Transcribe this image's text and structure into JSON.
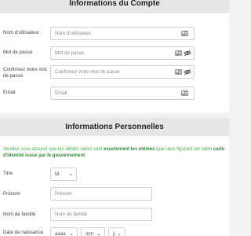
{
  "account": {
    "title": "Informations du Compte",
    "fields": [
      {
        "label": "Nom d'utilisateur",
        "placeholder": "Nom d'utilisateur"
      },
      {
        "label": "Mot de passe",
        "placeholder": "Mot de passe"
      },
      {
        "label": "Confirmez votre mot de passe",
        "placeholder": "Confirmez votre mot de passe"
      },
      {
        "label": "Email",
        "placeholder": "Email"
      }
    ],
    "icons": [
      "id-card-icon",
      "eye-slash-icon"
    ]
  },
  "personal": {
    "title": "Informations Personnelles",
    "notice": {
      "part1": "Veuillez vous assurer que les détails saisis sont ",
      "bold1": "exactement les mêmes",
      "part2": " que ceux figurant sur votre ",
      "bold2": "carte d'identité issue par le gouvernement"
    },
    "title_field": {
      "label": "Titre",
      "value": "M."
    },
    "first_name": {
      "label": "Prénom",
      "placeholder": "Prénom"
    },
    "last_name": {
      "label": "Nom de famille",
      "placeholder": "Nom de famille"
    },
    "birth_date": {
      "label": "Date de naissance",
      "year": "aaaa",
      "month": "mm",
      "day": "jj"
    }
  },
  "colors": {
    "notice_green": "#3fae45",
    "header_bg": "#e6e6e6"
  }
}
